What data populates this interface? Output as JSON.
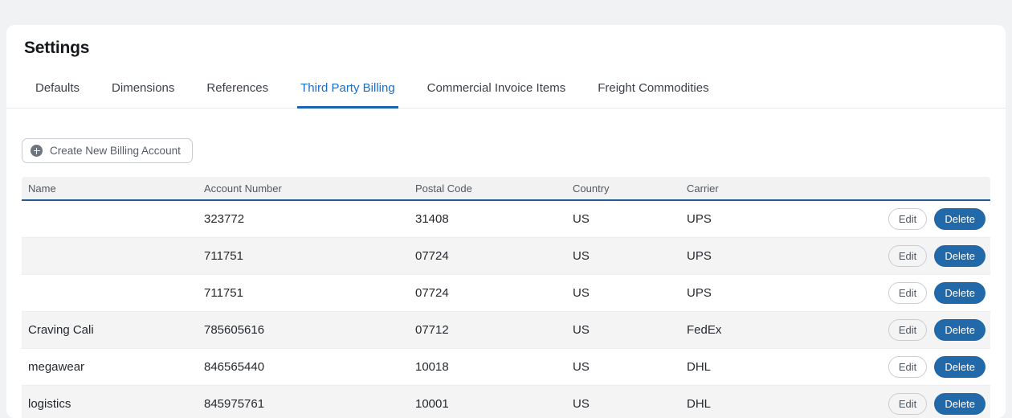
{
  "page": {
    "title": "Settings"
  },
  "tabs": [
    {
      "label": "Defaults",
      "active": false
    },
    {
      "label": "Dimensions",
      "active": false
    },
    {
      "label": "References",
      "active": false
    },
    {
      "label": "Third Party Billing",
      "active": true
    },
    {
      "label": "Commercial Invoice Items",
      "active": false
    },
    {
      "label": "Freight Commodities",
      "active": false
    }
  ],
  "toolbar": {
    "create_button": {
      "label": "Create New Billing Account",
      "icon": "plus-circle-icon"
    }
  },
  "table": {
    "columns": [
      {
        "label": "Name"
      },
      {
        "label": "Account Number"
      },
      {
        "label": "Postal Code"
      },
      {
        "label": "Country"
      },
      {
        "label": "Carrier"
      },
      {
        "label": ""
      }
    ],
    "rows": [
      {
        "name": "",
        "account_number": "323772",
        "postal_code": "31408",
        "country": "US",
        "carrier": "UPS"
      },
      {
        "name": "",
        "account_number": "711751",
        "postal_code": "07724",
        "country": "US",
        "carrier": "UPS"
      },
      {
        "name": "",
        "account_number": "711751",
        "postal_code": "07724",
        "country": "US",
        "carrier": "UPS"
      },
      {
        "name": "Craving Cali",
        "account_number": "785605616",
        "postal_code": "07712",
        "country": "US",
        "carrier": "FedEx"
      },
      {
        "name": "megawear",
        "account_number": "846565440",
        "postal_code": "10018",
        "country": "US",
        "carrier": "DHL"
      },
      {
        "name": "logistics",
        "account_number": "845975761",
        "postal_code": "10001",
        "country": "US",
        "carrier": "DHL"
      }
    ],
    "row_actions": {
      "edit": "Edit",
      "delete": "Delete"
    }
  },
  "colors": {
    "accent_blue": "#1a6fc7",
    "tab_underline": "#1b63af",
    "header_border_blue": "#1d5e96",
    "delete_button_bg": "#2169a8",
    "page_background": "#f1f2f4",
    "stripe_row": "#f4f4f5"
  }
}
